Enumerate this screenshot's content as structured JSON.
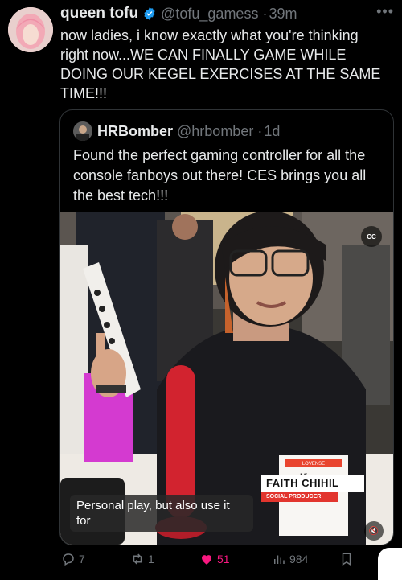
{
  "author": {
    "name": "queen tofu",
    "handle": "@tofu_gamess",
    "time": "39m"
  },
  "tweet": {
    "text": "now ladies, i know exactly what you're thinking right now...WE CAN FINALLY GAME WHILE DOING OUR KEGEL EXERCISES AT THE SAME TIME!!!"
  },
  "quoted": {
    "name": "HRBomber",
    "handle": "@hrbomber",
    "time": "1d",
    "text": "Found the perfect gaming controller for all the console fanboys out there! CES brings you all the best tech!!!"
  },
  "video": {
    "cc_label": "CC",
    "caption": "Personal play, but also use it for",
    "lower_third_name": "FAITH CHIHIL",
    "lower_third_title": "SOCIAL PRODUCER",
    "sign_top": "LOVENSE",
    "sign_partial": "Mi..."
  },
  "actions": {
    "replies": "7",
    "retweets": "1",
    "likes": "51",
    "views": "984"
  },
  "colors": {
    "accent_like": "#f91880",
    "verified": "#1d9bf0",
    "muted": "#71767b"
  },
  "icons": [
    "verified-badge-icon",
    "more-icon",
    "reply-icon",
    "retweet-icon",
    "heart-icon",
    "views-icon",
    "bookmark-icon",
    "mute-icon"
  ]
}
